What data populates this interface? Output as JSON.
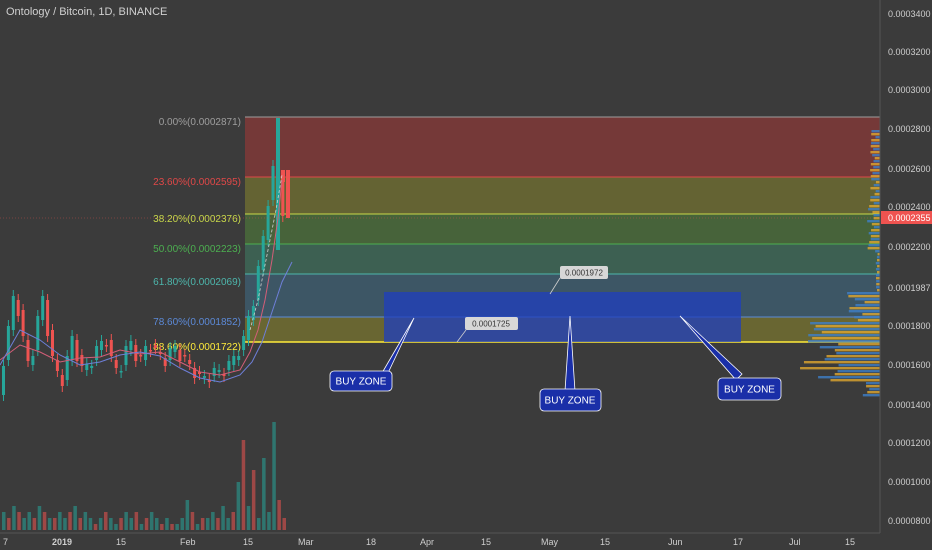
{
  "header": {
    "title": "Ontology / Bitcoin, 1D, BINANCE"
  },
  "colors": {
    "background": "#3b3b3b",
    "up_candle": "#26a69a",
    "down_candle": "#ef5350",
    "buy_zone_rect": "#1f3fbf",
    "buy_zone_label": "#1a2fa8",
    "last_price_badge": "#ef5350"
  },
  "price_axis": {
    "ticks": [
      "0.0003400",
      "0.0003200",
      "0.0003000",
      "0.0002800",
      "0.0002600",
      "0.0002400",
      "0.0002200",
      "0.0001987",
      "0.0001800",
      "0.0001600",
      "0.0001400",
      "0.0001200",
      "0.0001000",
      "0.0000800"
    ],
    "last_price": "0.0002355"
  },
  "time_axis": {
    "ticks": [
      "7",
      "2019",
      "15",
      "Feb",
      "15",
      "Mar",
      "18",
      "Apr",
      "15",
      "May",
      "15",
      "Jun",
      "17",
      "Jul",
      "15"
    ]
  },
  "fibonacci": [
    {
      "label": "0.00%(0.0002871)",
      "value": 0.0002871,
      "color": "#9e9e9e"
    },
    {
      "label": "23.60%(0.0002595)",
      "value": 0.0002595,
      "color": "#e04848"
    },
    {
      "label": "38.20%(0.0002376)",
      "value": 0.0002376,
      "color": "#c8d84a"
    },
    {
      "label": "50.00%(0.0002223)",
      "value": 0.0002223,
      "color": "#4caf50"
    },
    {
      "label": "61.80%(0.0002069)",
      "value": 0.0002069,
      "color": "#4db6ac"
    },
    {
      "label": "78.60%(0.0001852)",
      "value": 0.0001852,
      "color": "#5c8ad8"
    },
    {
      "label": "88.60%(0.0001722)",
      "value": 0.0001722,
      "color": "#ffeb3b"
    }
  ],
  "annotations": {
    "buy_zone_labels": [
      "BUY ZONE",
      "BUY ZONE",
      "BUY ZONE"
    ],
    "price_notes": [
      "0.0001972",
      "0.0001725"
    ]
  },
  "chart_data": {
    "type": "candlestick",
    "title": "Ontology / Bitcoin, 1D, BINANCE",
    "ylim": [
      8e-05,
      0.00034
    ],
    "volume_bars": [
      3,
      2,
      4,
      3,
      2,
      3,
      2,
      4,
      3,
      2,
      2,
      3,
      2,
      3,
      4,
      2,
      3,
      2,
      1,
      2,
      3,
      2,
      1,
      2,
      3,
      2,
      3,
      1,
      2,
      3,
      2,
      1,
      2,
      1,
      1,
      2,
      5,
      3,
      1,
      2,
      2,
      3,
      2,
      4,
      2,
      3,
      8,
      15,
      4,
      10,
      2,
      12,
      3,
      18,
      5,
      2
    ],
    "volume_up": [
      1,
      0,
      1,
      0,
      1,
      1,
      0,
      1,
      0,
      1,
      0,
      1,
      1,
      0,
      1,
      0,
      1,
      1,
      0,
      1,
      0,
      1,
      1,
      0,
      1,
      1,
      0,
      1,
      0,
      1,
      1,
      0,
      1,
      0,
      1,
      1,
      1,
      0,
      1,
      0,
      1,
      1,
      0,
      1,
      1,
      0,
      1,
      0,
      1,
      0,
      1,
      1,
      1,
      1,
      0,
      0
    ]
  }
}
